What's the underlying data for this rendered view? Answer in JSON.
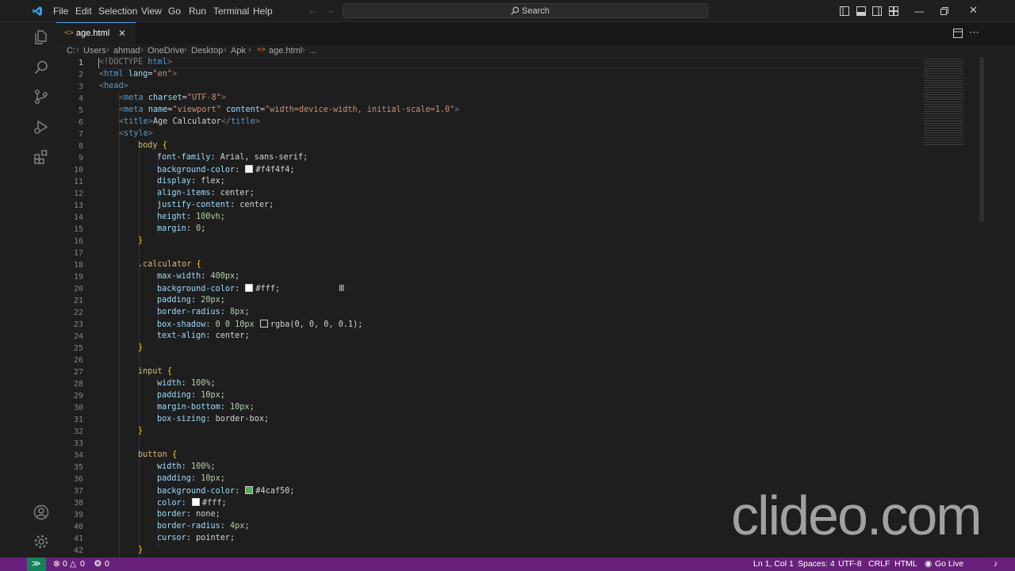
{
  "menu": {
    "file": "File",
    "edit": "Edit",
    "selection": "Selection",
    "view": "View",
    "go": "Go",
    "run": "Run",
    "terminal": "Terminal",
    "help": "Help"
  },
  "search": {
    "label": "Search"
  },
  "tab": {
    "name": "age.html",
    "icon": "html-file-icon"
  },
  "breadcrumb": [
    "C:",
    "Users",
    "ahmad",
    "OneDrive",
    "Desktop",
    "Apk",
    "age.html",
    "..."
  ],
  "code": {
    "line_numbers": [
      "1",
      "2",
      "3",
      "4",
      "5",
      "6",
      "7",
      "8",
      "9",
      "10",
      "11",
      "12",
      "13",
      "14",
      "15",
      "16",
      "17",
      "18",
      "19",
      "20",
      "21",
      "22",
      "23",
      "24",
      "25",
      "26",
      "27",
      "28",
      "29",
      "30",
      "31",
      "32",
      "33",
      "34",
      "35",
      "36",
      "37",
      "38",
      "39",
      "40",
      "41",
      "42"
    ],
    "l1": [
      "<!DOCTYPE ",
      "html",
      ">"
    ],
    "l2": [
      "<",
      "html",
      " ",
      "lang",
      "=",
      "\"en\"",
      ">"
    ],
    "l3": [
      "<",
      "head",
      ">"
    ],
    "l4": [
      "<",
      "meta",
      " ",
      "charset",
      "=",
      "\"UTF-8\"",
      ">"
    ],
    "l5": [
      "<",
      "meta",
      " ",
      "name",
      "=",
      "\"viewport\"",
      " ",
      "content",
      "=",
      "\"width=device-width, initial-scale=1.0\"",
      ">"
    ],
    "l6": [
      "<",
      "title",
      ">",
      "Age Calculator",
      "</",
      "title",
      ">"
    ],
    "l7": [
      "<",
      "style",
      ">"
    ],
    "l8": [
      "body",
      " ",
      "{"
    ],
    "l9": [
      "font-family",
      ": ",
      "Arial, sans-serif",
      ";"
    ],
    "l10": [
      "background-color",
      ": ",
      "#f4f4f4",
      ";"
    ],
    "l11": [
      "display",
      ": ",
      "flex",
      ";"
    ],
    "l12": [
      "align-items",
      ": ",
      "center",
      ";"
    ],
    "l13": [
      "justify-content",
      ": ",
      "center",
      ";"
    ],
    "l14": [
      "height",
      ": ",
      "100vh",
      ";"
    ],
    "l15": [
      "margin",
      ": ",
      "0",
      ";"
    ],
    "l16": [
      "}"
    ],
    "l18": [
      ".calculator",
      " ",
      "{"
    ],
    "l19": [
      "max-width",
      ": ",
      "400px",
      ";"
    ],
    "l20": [
      "background-color",
      ": ",
      "#fff",
      ";"
    ],
    "l21": [
      "padding",
      ": ",
      "20px",
      ";"
    ],
    "l22": [
      "border-radius",
      ": ",
      "8px",
      ";"
    ],
    "l23": [
      "box-shadow",
      ": ",
      "0 0 10px ",
      "rgba(0, 0, 0, 0.1)",
      ";"
    ],
    "l24": [
      "text-align",
      ": ",
      "center",
      ";"
    ],
    "l25": [
      "}"
    ],
    "l27": [
      "input",
      " ",
      "{"
    ],
    "l28": [
      "width",
      ": ",
      "100%",
      ";"
    ],
    "l29": [
      "padding",
      ": ",
      "10px",
      ";"
    ],
    "l30": [
      "margin-bottom",
      ": ",
      "10px",
      ";"
    ],
    "l31": [
      "box-sizing",
      ": ",
      "border-box",
      ";"
    ],
    "l32": [
      "}"
    ],
    "l34": [
      "button",
      " ",
      "{"
    ],
    "l35": [
      "width",
      ": ",
      "100%",
      ";"
    ],
    "l36": [
      "padding",
      ": ",
      "10px",
      ";"
    ],
    "l37": [
      "background-color",
      ": ",
      "#4caf50",
      ";"
    ],
    "l38": [
      "color",
      ": ",
      "#fff",
      ";"
    ],
    "l39": [
      "border",
      ": ",
      "none",
      ";"
    ],
    "l40": [
      "border-radius",
      ": ",
      "4px",
      ";"
    ],
    "l41": [
      "cursor",
      ": ",
      "pointer",
      ";"
    ],
    "l42": [
      "}"
    ],
    "swatches": {
      "f4f4f4": "#f4f4f4",
      "fff": "#ffffff",
      "rgba": "rgba(0,0,0,0.1)",
      "green": "#4caf50"
    }
  },
  "status": {
    "errors": "0",
    "warnings": "0",
    "ports": "0",
    "position": "Ln 1, Col 1",
    "spaces": "Spaces: 4",
    "encoding": "UTF-8",
    "eol": "CRLF",
    "language": "HTML",
    "golive": "Go Live"
  },
  "watermark": "clideo.com",
  "colors": {
    "statusbar": "#68217a",
    "accent": "#007acc",
    "editor_bg": "#1e1e1e"
  }
}
